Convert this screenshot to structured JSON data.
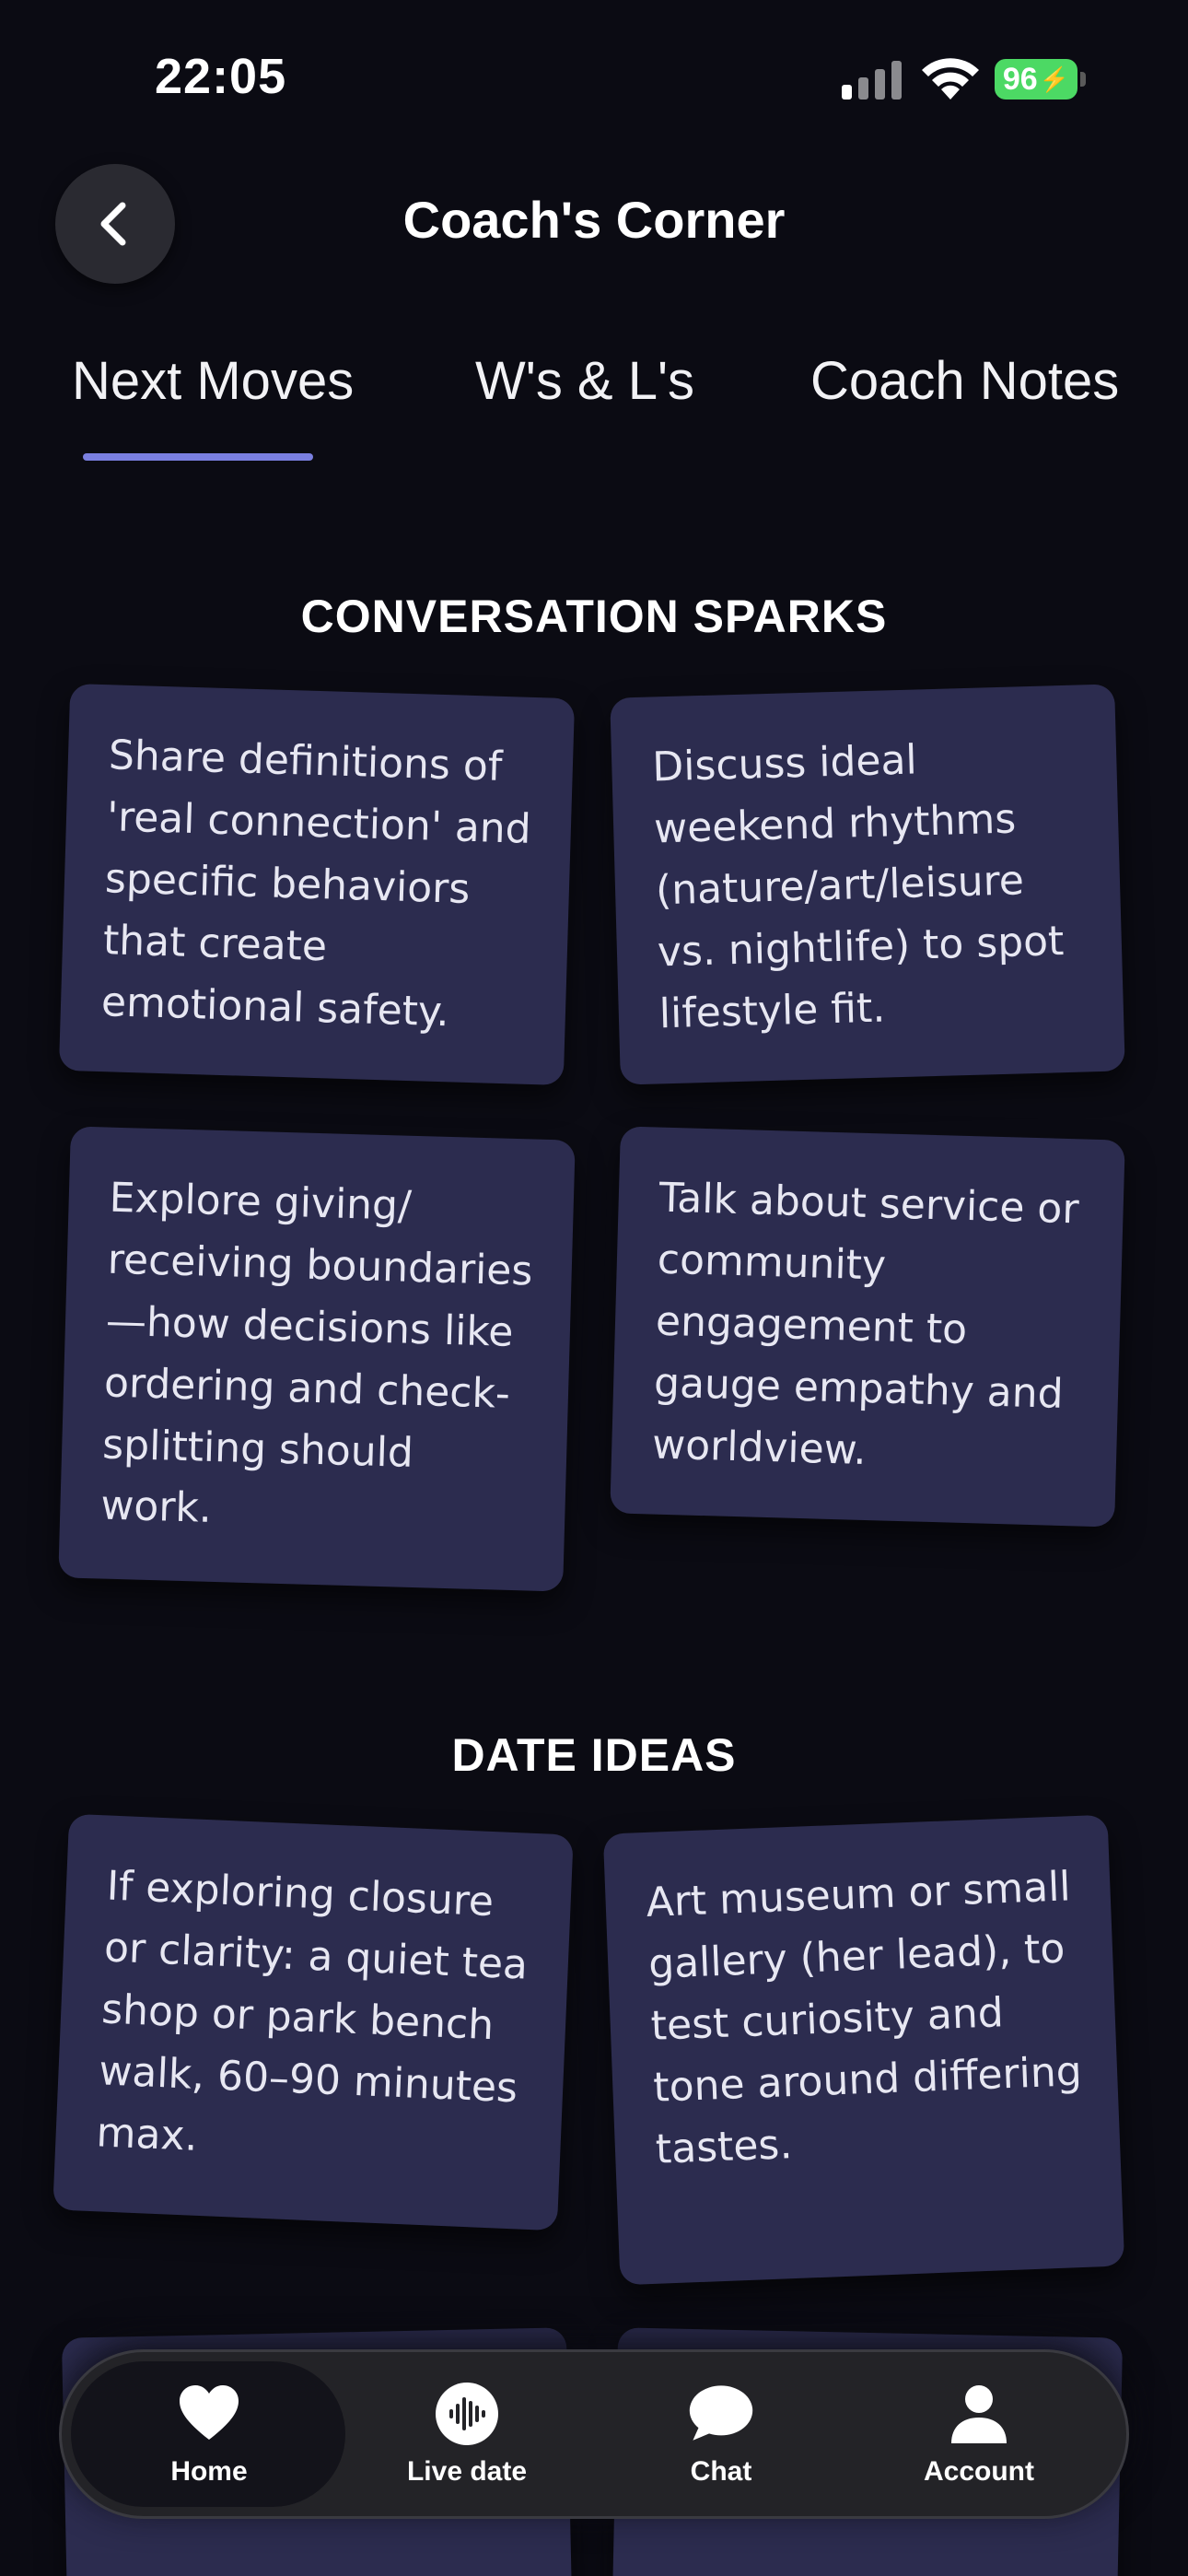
{
  "status_bar": {
    "time": "22:05",
    "battery": "96"
  },
  "header": {
    "title": "Coach's Corner"
  },
  "tabs": [
    {
      "label": "Next Moves",
      "active": true
    },
    {
      "label": "W's & L's",
      "active": false
    },
    {
      "label": "Coach Notes",
      "active": false
    }
  ],
  "sections": {
    "conversation_sparks": {
      "title": "CONVERSATION SPARKS",
      "cards": [
        "Share definitions of 'real connection' and specific behaviors that create emotional safety.",
        "Discuss ideal weekend rhythms (nature/art/leisure vs. nightlife) to spot lifestyle fit.",
        "Explore giving/ receiving boundaries —how decisions like ordering and check-splitting should work.",
        "Talk about service or community engagement to gauge empathy and worldview."
      ]
    },
    "date_ideas": {
      "title": "DATE IDEAS",
      "cards": [
        "If exploring closure or clarity: a quiet tea shop or park bench walk, 60–90 minutes max.",
        "Art museum or small gallery (her lead), to test curiosity and tone around differing tastes."
      ]
    }
  },
  "bottom_nav": [
    {
      "label": "Home",
      "icon": "heart-icon",
      "active": true
    },
    {
      "label": "Live date",
      "icon": "soundwave-icon",
      "active": false
    },
    {
      "label": "Chat",
      "icon": "chat-bubble-icon",
      "active": false
    },
    {
      "label": "Account",
      "icon": "person-icon",
      "active": false
    }
  ],
  "colors": {
    "background": "#0b0b13",
    "card": "#2c2c4f",
    "accent": "#7a7fe0",
    "battery": "#4cd964"
  }
}
